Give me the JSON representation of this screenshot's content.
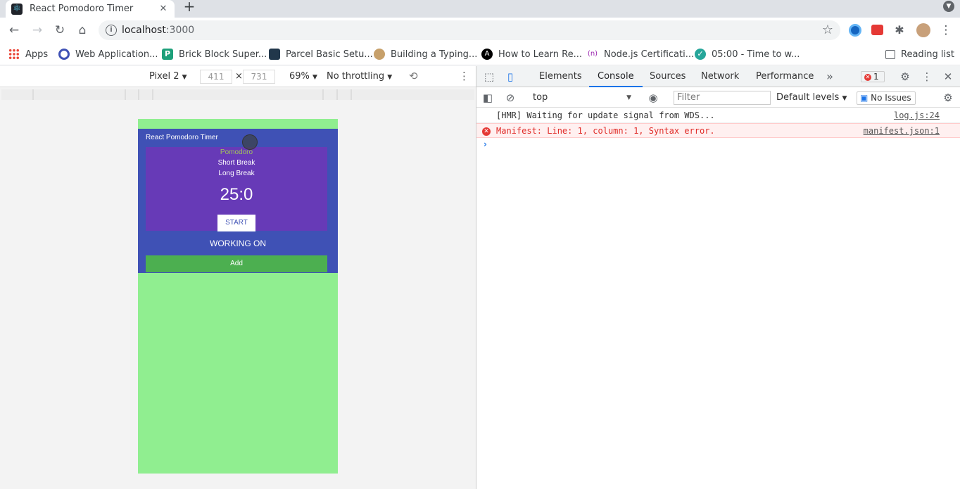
{
  "browser": {
    "tab_title": "React Pomodoro Timer",
    "url_host": "localhost",
    "url_port": ":3000"
  },
  "bookmarks": {
    "items": [
      {
        "label": "Apps",
        "icon": "apps-grid-icon"
      },
      {
        "label": "Web Application...",
        "icon": "circle-icon"
      },
      {
        "label": "Brick Block Super...",
        "icon": "p-icon"
      },
      {
        "label": "Parcel Basic Setu...",
        "icon": "rocket-icon"
      },
      {
        "label": "Building a Typing...",
        "icon": "monkey-icon"
      },
      {
        "label": "How to Learn Re...",
        "icon": "a-icon"
      },
      {
        "label": "Node.js Certificati...",
        "icon": "n-icon"
      },
      {
        "label": "05:00 - Time to w...",
        "icon": "check-icon"
      }
    ],
    "reading_list": "Reading list"
  },
  "device_toolbar": {
    "device": "Pixel 2",
    "width": "411",
    "times": "×",
    "height": "731",
    "zoom": "69%",
    "throttling": "No throttling"
  },
  "app": {
    "title": "React Pomodoro Timer",
    "modes": [
      "Pomodoro",
      "Short Break",
      "Long Break"
    ],
    "active_mode_color": "#a1c45a",
    "time": "25:0",
    "start_label": "START",
    "working_on": "WORKING ON",
    "add_label": "Add"
  },
  "devtools": {
    "tabs": [
      "Elements",
      "Console",
      "Sources",
      "Network",
      "Performance"
    ],
    "active_tab": "Console",
    "error_count": "1",
    "context": "top",
    "filter_placeholder": "Filter",
    "levels": "Default levels",
    "issues": "No Issues",
    "logs": [
      {
        "message": "[HMR] Waiting for update signal from WDS...",
        "source": "log.js:24",
        "level": "info"
      },
      {
        "message": "Manifest: Line: 1, column: 1, Syntax error.",
        "source": "manifest.json:1",
        "level": "error"
      }
    ]
  }
}
